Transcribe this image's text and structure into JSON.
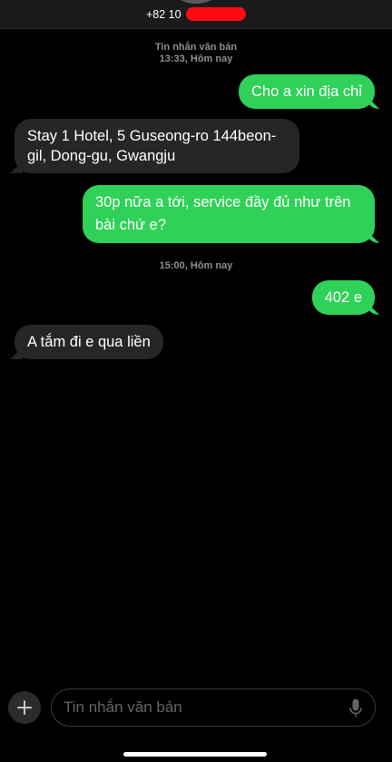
{
  "header": {
    "contact_number": "+82 10"
  },
  "thread": [
    {
      "type": "stamp",
      "label": "Tin nhắn văn bản",
      "time": "13:33, Hôm nay"
    },
    {
      "type": "message",
      "direction": "out",
      "text": "Cho a xin địa chỉ"
    },
    {
      "type": "message",
      "direction": "in",
      "text": "Stay 1 Hotel, 5 Guseong-ro 144beon-gil, Dong-gu, Gwangju"
    },
    {
      "type": "message",
      "direction": "out",
      "text": "30p nữa a tới, service đầy đủ như trên bài chứ e?"
    },
    {
      "type": "stamp",
      "time": "15:00, Hôm nay"
    },
    {
      "type": "message",
      "direction": "out",
      "text": "402 e"
    },
    {
      "type": "message",
      "direction": "in",
      "text": "A tắm đi e qua liền"
    }
  ],
  "composer": {
    "placeholder": "Tin nhắn văn bản",
    "plus_icon": "plus-icon",
    "mic_icon": "microphone-icon"
  },
  "colors": {
    "outgoing_bubble": "#30d158",
    "incoming_bubble": "#262629",
    "background": "#000000",
    "redaction": "#ff0a14"
  }
}
